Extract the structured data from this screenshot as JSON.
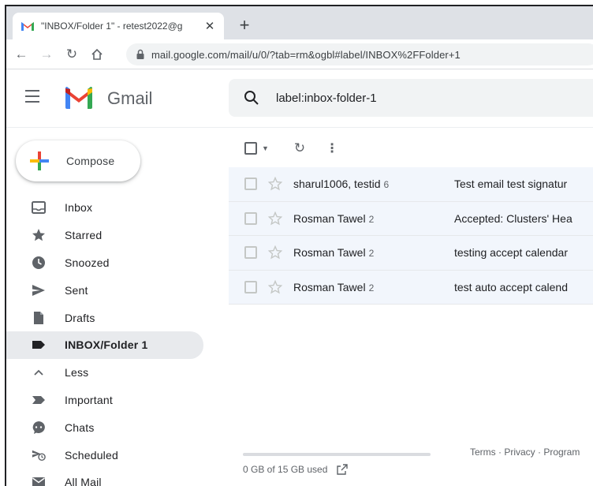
{
  "browser": {
    "tab_title": "\"INBOX/Folder 1\" - retest2022@g",
    "tab_close": "✕",
    "new_tab": "+",
    "url": "mail.google.com/mail/u/0/?tab=rm&ogbl#label/INBOX%2FFolder+1"
  },
  "header": {
    "brand": "Gmail",
    "search_value": "label:inbox-folder-1"
  },
  "compose_label": "Compose",
  "sidebar": {
    "items": [
      {
        "label": "Inbox",
        "icon": "inbox-icon"
      },
      {
        "label": "Starred",
        "icon": "star-icon"
      },
      {
        "label": "Snoozed",
        "icon": "clock-icon"
      },
      {
        "label": "Sent",
        "icon": "send-icon"
      },
      {
        "label": "Drafts",
        "icon": "draft-icon"
      },
      {
        "label": "INBOX/Folder 1",
        "icon": "label-icon",
        "active": true
      },
      {
        "label": "Less",
        "icon": "chevron-up-icon"
      },
      {
        "label": "Important",
        "icon": "important-icon"
      },
      {
        "label": "Chats",
        "icon": "chat-icon"
      },
      {
        "label": "Scheduled",
        "icon": "scheduled-icon"
      },
      {
        "label": "All Mail",
        "icon": "all-mail-icon"
      }
    ]
  },
  "emails": [
    {
      "sender": "sharul1006, testid",
      "count": "6",
      "subject": "Test email test signatur"
    },
    {
      "sender": "Rosman Tawel",
      "count": "2",
      "subject": "Accepted: Clusters' Hea"
    },
    {
      "sender": "Rosman Tawel",
      "count": "2",
      "subject": "testing accept calendar"
    },
    {
      "sender": "Rosman Tawel",
      "count": "2",
      "subject": "test auto accept calend"
    }
  ],
  "footer": {
    "storage_text": "0 GB of 15 GB used",
    "storage_used_fraction": 0,
    "links": "Terms · Privacy · Program"
  },
  "colors": {
    "gmail_red": "#ea4335",
    "gmail_blue": "#4285f4",
    "gmail_green": "#34a853",
    "gmail_yellow": "#fbbc04",
    "active_nav_bg": "#e8eaed"
  }
}
